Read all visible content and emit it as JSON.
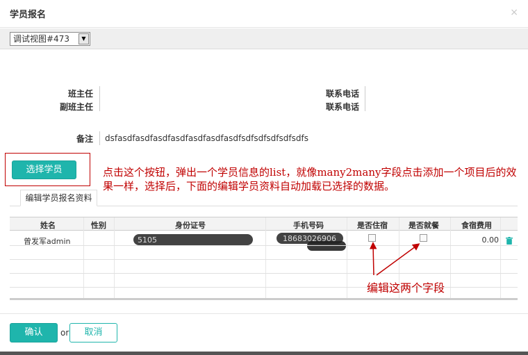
{
  "dialog": {
    "title": "学员报名",
    "close": "×"
  },
  "view_select": {
    "value": "调试视图#473",
    "arrow": "▼"
  },
  "form": {
    "head_teacher_label": "班主任",
    "deputy_teacher_label": "副班主任",
    "phone_label_1": "联系电话",
    "phone_label_2": "联系电话",
    "note_label": "备注",
    "note_value": "dsfasdfasdfasdfasdfasdfasdfasdfsdfsdfsdfsdfsdfs"
  },
  "pick_button": "选择学员",
  "annotations": {
    "top": "点击这个按钮，弹出一个学员信息的list，就像many2many字段点击添加一个项目后的效果一样，选择后，下面的编辑学员资料自动加载已选择的数据。",
    "bottom": "编辑这两个字段"
  },
  "tab": {
    "label": "编辑学员报名资料"
  },
  "table": {
    "headers": [
      "姓名",
      "性别",
      "身份证号",
      "手机号码",
      "是否住宿",
      "是否就餐",
      "食宿费用"
    ],
    "rows": [
      {
        "name": "曾发军admin",
        "gender": "",
        "id_number": "5105",
        "phone": "18683026906",
        "lodging": false,
        "meals": false,
        "fee": "0.00"
      }
    ]
  },
  "footer": {
    "confirm": "确认",
    "or": "or",
    "cancel": "取消"
  },
  "colors": {
    "teal": "#1fb5ac",
    "annotation_red": "#c00000"
  }
}
